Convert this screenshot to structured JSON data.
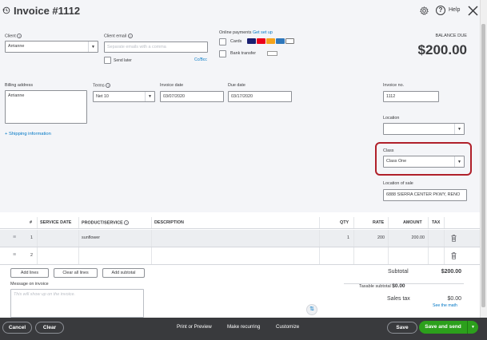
{
  "header": {
    "title": "Invoice #1112",
    "help_label": "Help"
  },
  "client": {
    "label": "Client",
    "value": "Arrianne"
  },
  "client_email": {
    "label": "Client email",
    "placeholder": "Separate emails with a comma",
    "send_later_label": "Send later",
    "ccbcc_label": "Cc/Bcc"
  },
  "online_payments": {
    "label": "Online payments",
    "get_set_up": "Get set up",
    "cards_label": "Cards",
    "bank_transfer_label": "Bank transfer"
  },
  "balance": {
    "label": "BALANCE DUE",
    "amount": "$200.00"
  },
  "billing_address": {
    "label": "Billing address",
    "value": "Arrianne"
  },
  "terms": {
    "label": "Terms",
    "value": "Net 10"
  },
  "invoice_date": {
    "label": "Invoice date",
    "value": "03/07/2020"
  },
  "due_date": {
    "label": "Due date",
    "value": "03/17/2020"
  },
  "invoice_no": {
    "label": "Invoice no.",
    "value": "1112"
  },
  "shipping_link": "+ Shipping information",
  "location": {
    "label": "Location",
    "value": ""
  },
  "class": {
    "label": "Class",
    "value": "Class One"
  },
  "location_of_sale": {
    "label": "Location of sale",
    "value": "6888 SIERRA CENTER PKWY, RENO"
  },
  "table": {
    "headers": {
      "num": "#",
      "service_date": "SERVICE DATE",
      "product": "PRODUCT/SERVICE",
      "description": "DESCRIPTION",
      "qty": "QTY",
      "rate": "RATE",
      "amount": "AMOUNT",
      "tax": "TAX"
    },
    "rows": [
      {
        "num": "1",
        "service_date": "",
        "product": "sunflower",
        "description": "",
        "qty": "1",
        "rate": "200",
        "amount": "200.00"
      },
      {
        "num": "2",
        "service_date": "",
        "product": "",
        "description": "",
        "qty": "",
        "rate": "",
        "amount": ""
      }
    ]
  },
  "line_buttons": {
    "add_lines": "Add lines",
    "clear_all_lines": "Clear all lines",
    "add_subtotal": "Add subtotal"
  },
  "message": {
    "label": "Message on invoice",
    "placeholder": "This will show up on the invoice."
  },
  "totals": {
    "subtotal_label": "Subtotal",
    "subtotal_value": "$200.00",
    "taxable_subtotal_label": "Taxable subtotal",
    "taxable_subtotal_value": "$0.00",
    "sales_tax_label": "Sales tax",
    "sales_tax_value": "$0.00",
    "see_the_math": "See the math"
  },
  "footer": {
    "cancel": "Cancel",
    "clear": "Clear",
    "print_preview": "Print or Preview",
    "make_recurring": "Make recurring",
    "customize": "Customize",
    "save": "Save",
    "save_and_send": "Save and send"
  },
  "colors": {
    "brand_green": "#2ca01c",
    "link_blue": "#0077c5",
    "footer_bg": "#393a3d",
    "highlight_red": "#b0202a"
  },
  "icons": {
    "history": "history-icon",
    "settings": "gear-icon",
    "help": "help-icon",
    "close": "close-icon",
    "delete": "trash-icon",
    "drag": "drag-handle-icon"
  }
}
